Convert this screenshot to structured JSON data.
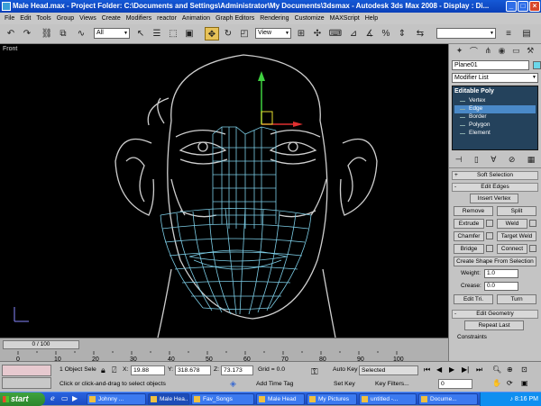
{
  "window": {
    "title": "Male Head.max - Project Folder: C:\\Documents and Settings\\Administrator\\My Documents\\3dsmax - Autodesk 3ds Max 2008 - Display : Di..."
  },
  "menu": [
    "File",
    "Edit",
    "Tools",
    "Group",
    "Views",
    "Create",
    "Modifiers",
    "reactor",
    "Animation",
    "Graph Editors",
    "Rendering",
    "Customize",
    "MAXScript",
    "Help"
  ],
  "toolbar": {
    "selection_filter": "All",
    "ref_coord": "View"
  },
  "viewport": {
    "label": "Front"
  },
  "command_panel": {
    "object_name": "Plane01",
    "modifier_list": "Modifier List",
    "stack_root": "Editable Poly",
    "stack_items": [
      "Vertex",
      "Edge",
      "Border",
      "Polygon",
      "Element"
    ],
    "selected_item": "Edge",
    "soft_selection": "Soft Selection",
    "edit_edges": "Edit Edges",
    "insert_vertex": "Insert Vertex",
    "remove": "Remove",
    "split": "Split",
    "extrude": "Extrude",
    "weld": "Weld",
    "chamfer": "Chamfer",
    "target_weld": "Target Weld",
    "bridge": "Bridge",
    "connect": "Connect",
    "create_shape": "Create Shape From Selection",
    "weight_label": "Weight:",
    "weight_value": "1.0",
    "crease_label": "Crease:",
    "crease_value": "0.0",
    "edit_tri": "Edit Tri.",
    "turn": "Turn",
    "edit_geometry": "Edit Geometry",
    "repeat_last": "Repeat Last",
    "constraints": "Constraints"
  },
  "trackbar": {
    "frame": "0 / 100",
    "ticks": [
      "0",
      "10",
      "20",
      "30",
      "40",
      "50",
      "60",
      "70",
      "80",
      "90",
      "100"
    ]
  },
  "status": {
    "selection": "1 Object Sele",
    "x_label": "X:",
    "x_value": "19.88",
    "y_label": "Y:",
    "y_value": "318.678",
    "z_label": "Z:",
    "z_value": "73.173",
    "grid": "Grid = 0.0",
    "auto_key": "Auto Key",
    "selected": "Selected",
    "set_key": "Set Key",
    "key_filters": "Key Filters...",
    "frame_field": "0",
    "prompt": "Click or click-and-drag to select objects",
    "add_time_tag": "Add Time Tag"
  },
  "taskbar": {
    "start": "start",
    "tasks": [
      "Johnny ...",
      "Male Hea...",
      "Fav_Songs",
      "Male Head",
      "My Pictures",
      "untitled -...",
      "Docume..."
    ],
    "active_task": 1,
    "clock": "8:16 PM"
  }
}
